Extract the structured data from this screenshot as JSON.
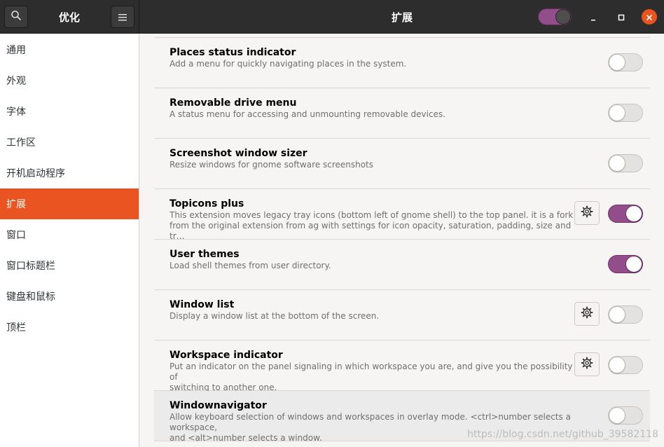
{
  "header": {
    "sidebar_title": "优化",
    "main_title": "扩展",
    "master_switch_on": true,
    "accent_color": "#e95420",
    "switch_on_color": "#924d8b"
  },
  "sidebar": {
    "items": [
      {
        "label": "通用",
        "active": false
      },
      {
        "label": "外观",
        "active": false
      },
      {
        "label": "字体",
        "active": false
      },
      {
        "label": "工作区",
        "active": false
      },
      {
        "label": "开机启动程序",
        "active": false
      },
      {
        "label": "扩展",
        "active": true
      },
      {
        "label": "窗口",
        "active": false
      },
      {
        "label": "窗口标题栏",
        "active": false
      },
      {
        "label": "键盘和鼠标",
        "active": false
      },
      {
        "label": "顶栏",
        "active": false
      }
    ]
  },
  "extensions": [
    {
      "name": "Places status indicator",
      "description": "Add a menu for quickly navigating places in the system.",
      "has_settings": false,
      "enabled": false
    },
    {
      "name": "Removable drive menu",
      "description": "A status menu for accessing and unmounting removable devices.",
      "has_settings": false,
      "enabled": false
    },
    {
      "name": "Screenshot window sizer",
      "description": "Resize windows for gnome software screenshots",
      "has_settings": false,
      "enabled": false
    },
    {
      "name": "Topicons plus",
      "description": "This extension moves legacy tray icons (bottom left of gnome shell) to the top panel. it is a fork\nfrom the original extension from ag  with settings for icon opacity, saturation, padding, size and tr…",
      "has_settings": true,
      "enabled": true
    },
    {
      "name": "User themes",
      "description": "Load shell themes from user directory.",
      "has_settings": false,
      "enabled": true
    },
    {
      "name": "Window list",
      "description": "Display a window list at the bottom of the screen.",
      "has_settings": true,
      "enabled": false
    },
    {
      "name": "Workspace indicator",
      "description": "Put an indicator on the panel signaling in which workspace you are, and give you the possibility of\nswitching to another one.",
      "has_settings": true,
      "enabled": false
    },
    {
      "name": "Windownavigator",
      "description": "Allow keyboard selection of windows and workspaces in overlay mode. <ctrl>number selects a workspace,\nand <alt>number selects a window.",
      "has_settings": false,
      "enabled": false
    }
  ],
  "watermark": "https://blog.csdn.net/github_39582118"
}
